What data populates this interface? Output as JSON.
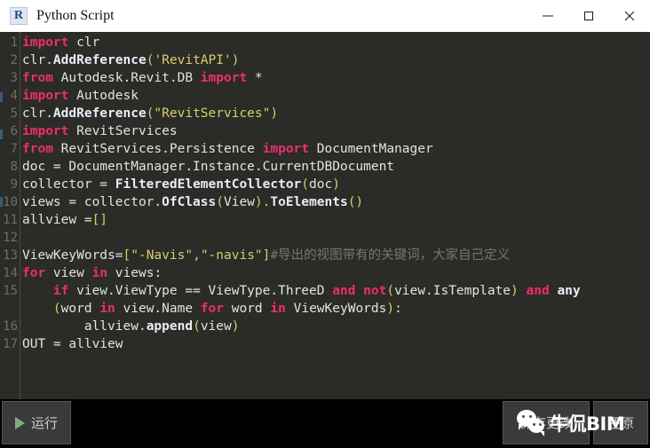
{
  "window": {
    "title": "Python Script",
    "icon": "revit-dynamo-icon",
    "icon_letter": "R",
    "controls": {
      "minimize": "minimize-icon",
      "maximize": "maximize-icon",
      "close": "close-icon"
    }
  },
  "editor": {
    "language": "python",
    "background_color": "#2b2b28",
    "gutter_color": "#6f6f68",
    "total_numbered_lines": 17,
    "colors": {
      "keyword": "#ec2e6e",
      "function": "#e8eef6",
      "string": "#d6cf6a",
      "comment": "#77776e",
      "plain": "#e4e4dc"
    },
    "lines": [
      {
        "no": "1",
        "tokens": [
          {
            "t": "import",
            "c": "kw"
          },
          {
            "t": " clr",
            "c": "pl"
          }
        ]
      },
      {
        "no": "2",
        "tokens": [
          {
            "t": "clr.",
            "c": "pl"
          },
          {
            "t": "AddReference",
            "c": "fn"
          },
          {
            "t": "(",
            "c": "pun"
          },
          {
            "t": "'RevitAPI'",
            "c": "str"
          },
          {
            "t": ")",
            "c": "pun"
          }
        ]
      },
      {
        "no": "3",
        "tokens": [
          {
            "t": "from",
            "c": "kw"
          },
          {
            "t": " Autodesk.Revit.DB ",
            "c": "pl"
          },
          {
            "t": "import",
            "c": "kw"
          },
          {
            "t": " *",
            "c": "pl"
          }
        ]
      },
      {
        "no": "4",
        "tokens": [
          {
            "t": "import",
            "c": "kw"
          },
          {
            "t": " Autodesk",
            "c": "pl"
          }
        ]
      },
      {
        "no": "5",
        "tokens": [
          {
            "t": "clr.",
            "c": "pl"
          },
          {
            "t": "AddReference",
            "c": "fn"
          },
          {
            "t": "(",
            "c": "pun"
          },
          {
            "t": "\"RevitServices\"",
            "c": "str"
          },
          {
            "t": ")",
            "c": "pun"
          }
        ]
      },
      {
        "no": "6",
        "tokens": [
          {
            "t": "import",
            "c": "kw"
          },
          {
            "t": " RevitServices",
            "c": "pl"
          }
        ]
      },
      {
        "no": "7",
        "tokens": [
          {
            "t": "from",
            "c": "kw"
          },
          {
            "t": " RevitServices.Persistence ",
            "c": "pl"
          },
          {
            "t": "import",
            "c": "kw"
          },
          {
            "t": " DocumentManager",
            "c": "pl"
          }
        ]
      },
      {
        "no": "8",
        "tokens": [
          {
            "t": "doc = DocumentManager.Instance.CurrentDBDocument",
            "c": "pl"
          }
        ]
      },
      {
        "no": "9",
        "tokens": [
          {
            "t": "collector = ",
            "c": "pl"
          },
          {
            "t": "FilteredElementCollector",
            "c": "fn"
          },
          {
            "t": "(",
            "c": "pun"
          },
          {
            "t": "doc",
            "c": "pl"
          },
          {
            "t": ")",
            "c": "pun"
          }
        ]
      },
      {
        "no": "10",
        "tokens": [
          {
            "t": "views = collector.",
            "c": "pl"
          },
          {
            "t": "OfClass",
            "c": "fn"
          },
          {
            "t": "(",
            "c": "pun"
          },
          {
            "t": "View",
            "c": "pl"
          },
          {
            "t": ").",
            "c": "pun"
          },
          {
            "t": "ToElements",
            "c": "fn"
          },
          {
            "t": "()",
            "c": "pun"
          }
        ]
      },
      {
        "no": "11",
        "tokens": [
          {
            "t": "allview =",
            "c": "pl"
          },
          {
            "t": "[]",
            "c": "pun"
          }
        ]
      },
      {
        "no": "12",
        "tokens": []
      },
      {
        "no": "13",
        "tokens": [
          {
            "t": "ViewKeyWords=",
            "c": "pl"
          },
          {
            "t": "[",
            "c": "pun"
          },
          {
            "t": "\"-Navis\"",
            "c": "str"
          },
          {
            "t": ",",
            "c": "pun"
          },
          {
            "t": "\"-navis\"",
            "c": "str"
          },
          {
            "t": "]",
            "c": "pun"
          },
          {
            "t": "#导出的视图带有的关键词，大家自己定义",
            "c": "cmt"
          }
        ]
      },
      {
        "no": "14",
        "tokens": [
          {
            "t": "for",
            "c": "kw"
          },
          {
            "t": " view ",
            "c": "pl"
          },
          {
            "t": "in",
            "c": "kw"
          },
          {
            "t": " views:",
            "c": "pl"
          }
        ]
      },
      {
        "no": "15",
        "tokens": [
          {
            "t": "    ",
            "c": "pl"
          },
          {
            "t": "if",
            "c": "kw"
          },
          {
            "t": " view.ViewType == ViewType.ThreeD ",
            "c": "pl"
          },
          {
            "t": "and",
            "c": "kw"
          },
          {
            "t": " ",
            "c": "pl"
          },
          {
            "t": "not",
            "c": "kw"
          },
          {
            "t": "(",
            "c": "pun"
          },
          {
            "t": "view.IsTemplate",
            "c": "pl"
          },
          {
            "t": ")",
            "c": "pun"
          },
          {
            "t": " ",
            "c": "pl"
          },
          {
            "t": "and",
            "c": "kw"
          },
          {
            "t": " ",
            "c": "pl"
          },
          {
            "t": "any",
            "c": "bi"
          }
        ]
      },
      {
        "no": "",
        "tokens": [
          {
            "t": "    ",
            "c": "pl"
          },
          {
            "t": "(",
            "c": "pun"
          },
          {
            "t": "word ",
            "c": "pl"
          },
          {
            "t": "in",
            "c": "kw"
          },
          {
            "t": " view.Name ",
            "c": "pl"
          },
          {
            "t": "for",
            "c": "kw"
          },
          {
            "t": " word ",
            "c": "pl"
          },
          {
            "t": "in",
            "c": "kw"
          },
          {
            "t": " ViewKeyWords",
            "c": "pl"
          },
          {
            "t": ")",
            "c": "pun"
          },
          {
            "t": ":",
            "c": "pl"
          }
        ]
      },
      {
        "no": "16",
        "tokens": [
          {
            "t": "        allview.",
            "c": "pl"
          },
          {
            "t": "append",
            "c": "fn"
          },
          {
            "t": "(",
            "c": "pun"
          },
          {
            "t": "view",
            "c": "pl"
          },
          {
            "t": ")",
            "c": "pun"
          }
        ]
      },
      {
        "no": "17",
        "tokens": [
          {
            "t": "OUT = allview",
            "c": "pl"
          }
        ]
      }
    ]
  },
  "bottom_bar": {
    "run_label": "运行",
    "run_icon": "play-icon",
    "save_label": "保存更改",
    "revert_label": "还原"
  },
  "watermark": {
    "text": "牛侃BIM",
    "logo": "wechat-icon"
  }
}
